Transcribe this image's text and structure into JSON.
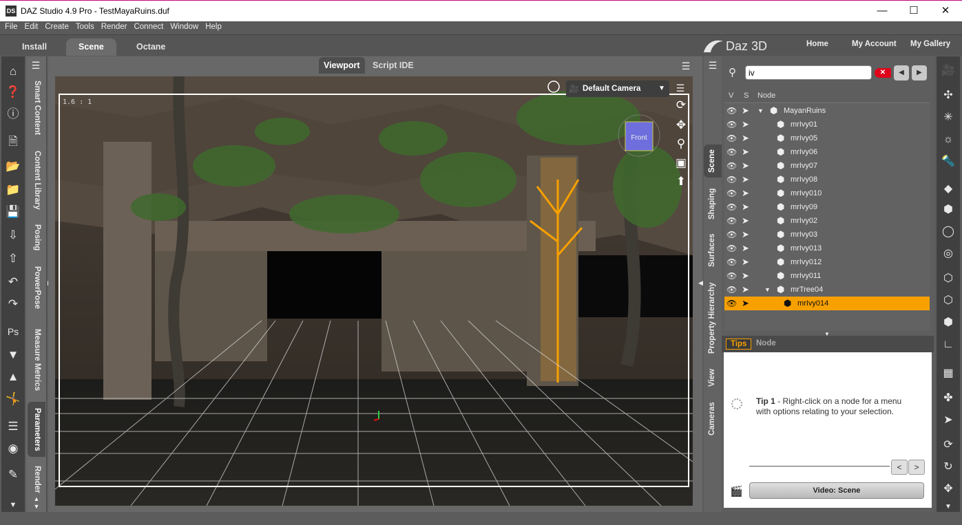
{
  "window": {
    "title": "DAZ Studio 4.9 Pro - TestMayaRuins.duf",
    "app_icon": "DS"
  },
  "menu": [
    "File",
    "Edit",
    "Create",
    "Tools",
    "Render",
    "Connect",
    "Window",
    "Help"
  ],
  "main_tabs": [
    "Install",
    "Scene",
    "Octane"
  ],
  "brand": {
    "logo_text": "Daz 3D",
    "links": [
      "Home",
      "My Account",
      "My Gallery"
    ]
  },
  "left_panel_tabs": [
    "Smart Content",
    "Content Library",
    "Posing",
    "PowerPose",
    "Measure Metrics",
    "Parameters",
    "Render"
  ],
  "center_tabs": [
    "Viewport",
    "Script IDE"
  ],
  "viewport": {
    "camera": "Default Camera",
    "ratio": "1.6 : 1",
    "cube_label": "Front"
  },
  "right_panel_tabs": [
    "Scene",
    "Shaping",
    "Surfaces",
    "Property Hierarchy",
    "View",
    "Cameras"
  ],
  "scene": {
    "search_value": "iv",
    "columns": [
      "V",
      "S",
      "Node"
    ],
    "nodes": [
      {
        "name": "MayanRuins",
        "level": 0,
        "expanded": true
      },
      {
        "name": "mrIvy01",
        "level": 1
      },
      {
        "name": "mrIvy05",
        "level": 1
      },
      {
        "name": "mrIvy06",
        "level": 1
      },
      {
        "name": "mrIvy07",
        "level": 1
      },
      {
        "name": "mrIvy08",
        "level": 1
      },
      {
        "name": "mrIvy010",
        "level": 1
      },
      {
        "name": "mrIvy09",
        "level": 1
      },
      {
        "name": "mrIvy02",
        "level": 1
      },
      {
        "name": "mrIvy03",
        "level": 1
      },
      {
        "name": "mrIvy013",
        "level": 1
      },
      {
        "name": "mrIvy012",
        "level": 1
      },
      {
        "name": "mrIvy011",
        "level": 1
      },
      {
        "name": "mrTree04",
        "level": 1,
        "expanded": true
      },
      {
        "name": "mrIvy014",
        "level": 2,
        "selected": true
      }
    ]
  },
  "tips": {
    "tabs": [
      "Tips",
      "Node"
    ],
    "title": "Tip 1",
    "text": " - Right-click on a node for a menu with options relating to your selection.",
    "prev": "<",
    "next": ">",
    "video_button": "Video: Scene"
  },
  "colors": {
    "accent": "#f7a000",
    "selected_row": "#f7a000",
    "clear_search": "#e0001a"
  }
}
